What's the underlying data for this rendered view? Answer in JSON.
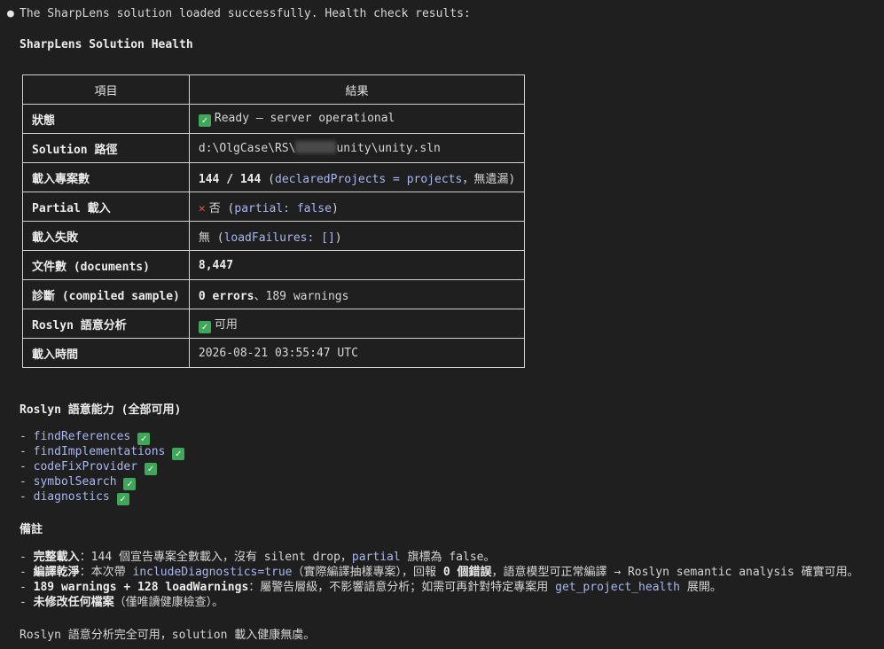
{
  "intro": "The SharpLens solution loaded successfully. Health check results:",
  "title": "SharpLens Solution Health",
  "table": {
    "headers": [
      "項目",
      "結果"
    ],
    "rows": [
      {
        "key": "狀態",
        "value": "Ready — server operational"
      },
      {
        "key": "Solution 路徑",
        "path_prefix": "d:\\OlgCase\\RS\\",
        "path_suffix": "unity\\unity.sln"
      },
      {
        "key": "載入專案數",
        "count": "144 / 144",
        "paren_open": " (",
        "code": "declaredProjects = projects",
        "tail": "，無遺漏)"
      },
      {
        "key": "Partial 載入",
        "value": "否",
        "paren_open": " (",
        "code": "partial: false",
        "tail": ")"
      },
      {
        "key": "載入失敗",
        "value": "無",
        "paren_open": " (",
        "code": "loadFailures: []",
        "tail": ")"
      },
      {
        "key": "文件數 (documents)",
        "value": "8,447"
      },
      {
        "key": "診斷 (compiled sample)",
        "errors": "0 errors",
        "warnings": "、189 warnings"
      },
      {
        "key": "Roslyn 語意分析",
        "value": "可用"
      },
      {
        "key": "載入時間",
        "value": "2026-08-21 03:55:47 UTC"
      }
    ]
  },
  "capabilities": {
    "title": "Roslyn 語意能力 (全部可用)",
    "items": [
      "findReferences",
      "findImplementations",
      "codeFixProvider",
      "symbolSearch",
      "diagnostics"
    ]
  },
  "notes": {
    "title": "備註",
    "n1_bold": "完整載入",
    "n1_text": "：144 個宣告專案全數載入，沒有 silent drop，",
    "n1_code": "partial",
    "n1_tail": " 旗標為 false。",
    "n2_bold": "編譯乾淨",
    "n2_text": "：本次帶 ",
    "n2_code": "includeDiagnostics=true",
    "n2_mid": "（實際編譯抽樣專案），回報 ",
    "n2_bold2": "0 個錯誤",
    "n2_tail": "，語意模型可正常編譯 → Roslyn semantic analysis 確實可用。",
    "n3_bold": "189 warnings + 128 loadWarnings",
    "n3_text": "：屬警告層級，不影響語意分析；如需可再針對特定專案用 ",
    "n3_code": "get_project_health",
    "n3_tail": " 展開。",
    "n4_bold": "未修改任何檔案",
    "n4_tail": "（僅唯讀健康檢查）。"
  },
  "footer": "Roslyn 語意分析完全可用，solution 載入健康無虞。"
}
